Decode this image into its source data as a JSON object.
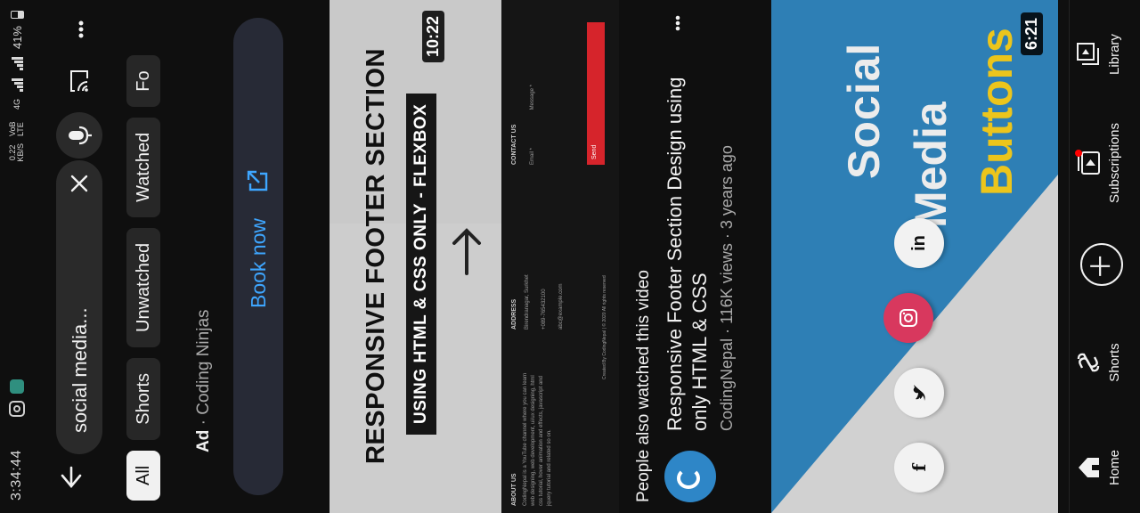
{
  "status_bar": {
    "time": "3:34:44",
    "data_rate": "0.22",
    "data_unit": "KB/S",
    "volte": "VoB LTE",
    "network": "4G",
    "battery": "41%"
  },
  "header": {
    "search_query": "social media...",
    "icons": [
      "back-arrow-icon",
      "clear-icon",
      "mic-icon",
      "cast-icon",
      "more-vert-icon"
    ]
  },
  "filters": {
    "chips": [
      "All",
      "Shorts",
      "Unwatched",
      "Watched",
      "Fo"
    ]
  },
  "ad": {
    "label": "Ad",
    "separator": "·",
    "advertiser": "Coding Ninjas",
    "cta": "Book now"
  },
  "ad_thumbnail": {
    "headline": "RESPONSIVE FOOTER SECTION",
    "subheadline": "USING HTML & CSS ONLY - FLEXBOX",
    "duration": "10:22",
    "mock": {
      "about_heading": "ABOUT US",
      "about_text": "CodingNepal is a YouTube channel where you can learn web designing, web development, ui/ux designing, html css tutorial, hover animation and effects, javascript and jquery tutorial and related so on.",
      "address_heading": "ADDRESS",
      "address": "Birendranagar, Surkhet",
      "phone": "+089-765432100",
      "email": "abc@example.com",
      "contact_heading": "CONTACT US",
      "email_placeholder": "Email *",
      "message_placeholder": "Message *",
      "send": "Send",
      "copyright": "Created By CodingNepal | © 2020 All rights reserved"
    }
  },
  "related": {
    "section_title": "People also watched this video",
    "video_title": "Responsive Footer Section Design using only HTML & CSS",
    "channel": "CodingNepal",
    "views": "116K views",
    "age": "3 years ago",
    "separator": "·"
  },
  "second_thumbnail": {
    "line1": "Social",
    "line2": "Media",
    "line3": "Buttons",
    "duration": "6:21",
    "socials": [
      "f",
      "bird",
      "ig",
      "in"
    ],
    "colors": {
      "blue": "#2e7fb5",
      "yellow": "#ecc51c",
      "instagram": "#d8385e"
    }
  },
  "bottom_nav": {
    "items": [
      "Home",
      "Shorts",
      "Subscriptions",
      "Library"
    ]
  }
}
